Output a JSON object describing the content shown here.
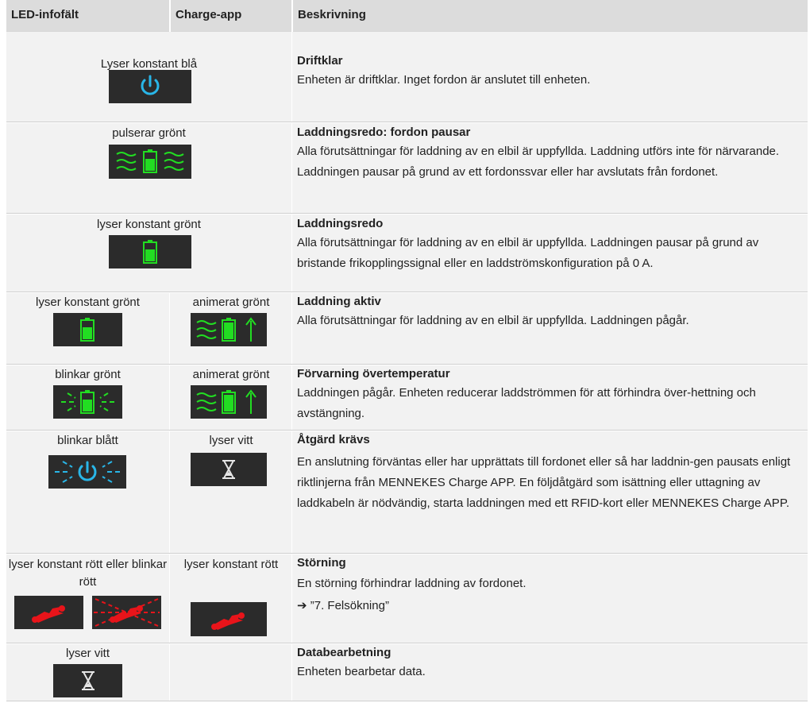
{
  "header": {
    "col_led": "LED-infofält",
    "col_app": "Charge-app",
    "col_desc": "Beskrivning"
  },
  "rows": [
    {
      "led_text": "Lyser konstant blå",
      "led_icon": "power-icon-blue",
      "title": "Driftklar",
      "body": "Enheten är driftklar. Inget fordon är anslutet till enheten."
    },
    {
      "led_text": "pulserar grönt",
      "led_icon": "battery-waves-icon-green",
      "title": "Laddningsredo: fordon pausar",
      "body": "Alla förutsättningar för laddning av en elbil är uppfyllda. Laddning utförs inte för närvarande. Laddningen pausar på grund av ett fordonssvar eller har avslutats från fordonet."
    },
    {
      "led_text": "lyser konstant grönt",
      "led_icon": "battery-icon-green",
      "title": "Laddningsredo",
      "body": "Alla förutsättningar för laddning av en elbil är uppfyllda. Laddningen pausar på grund av bristande frikopplingssignal eller en laddströmskonfiguration på 0 A."
    },
    {
      "led_text": "lyser konstant grönt",
      "led_icon": "battery-icon-green",
      "app_text": "animerat grönt",
      "app_icon": "battery-charging-icon-green",
      "title": "Laddning aktiv",
      "body": "Alla förutsättningar för laddning av en elbil är uppfyllda. Laddningen pågår."
    },
    {
      "led_text": "blinkar grönt",
      "led_icon": "battery-blink-icon-green",
      "app_text": "animerat grönt",
      "app_icon": "battery-charging-icon-green",
      "title": "Förvarning övertemperatur",
      "body": "Laddningen pågår. Enheten reducerar laddströmmen för att förhindra över-hettning och avstängning."
    },
    {
      "led_text": "blinkar blått",
      "led_icon": "power-blink-icon-blue",
      "app_text": "lyser vitt",
      "app_icon": "hourglass-icon-white",
      "title": "Åtgärd krävs",
      "body": "En anslutning förväntas eller har upprättats till fordonet eller så har laddnin-gen pausats enligt riktlinjerna från MENNEKES Charge APP. En följdåtgärd som isättning eller uttagning av laddkabeln är nödvändig, starta laddningen med ett RFID-kort eller MENNEKES Charge APP."
    },
    {
      "led_text": "lyser konstant rött eller blinkar rött",
      "led_icon": "wrench-icon-red",
      "app_text": "lyser konstant rött",
      "app_icon": "wrench-icon-red",
      "title": "Störning",
      "body": "En störning förhindrar laddning av fordonet.",
      "link": "➔  ”7. Felsökning”"
    },
    {
      "led_text": "lyser vitt",
      "led_icon": "hourglass-icon-white",
      "title": "Databearbetning",
      "body": "Enheten bearbetar data."
    }
  ],
  "colors": {
    "header_bg": "#dcdcdc",
    "row_bg": "#f2f2f2",
    "icon_bg": "#2b2b2b",
    "led_blue": "#29b6e8",
    "led_green": "#22dd22",
    "led_red": "#e8141a",
    "led_white": "#e6e6e6"
  }
}
